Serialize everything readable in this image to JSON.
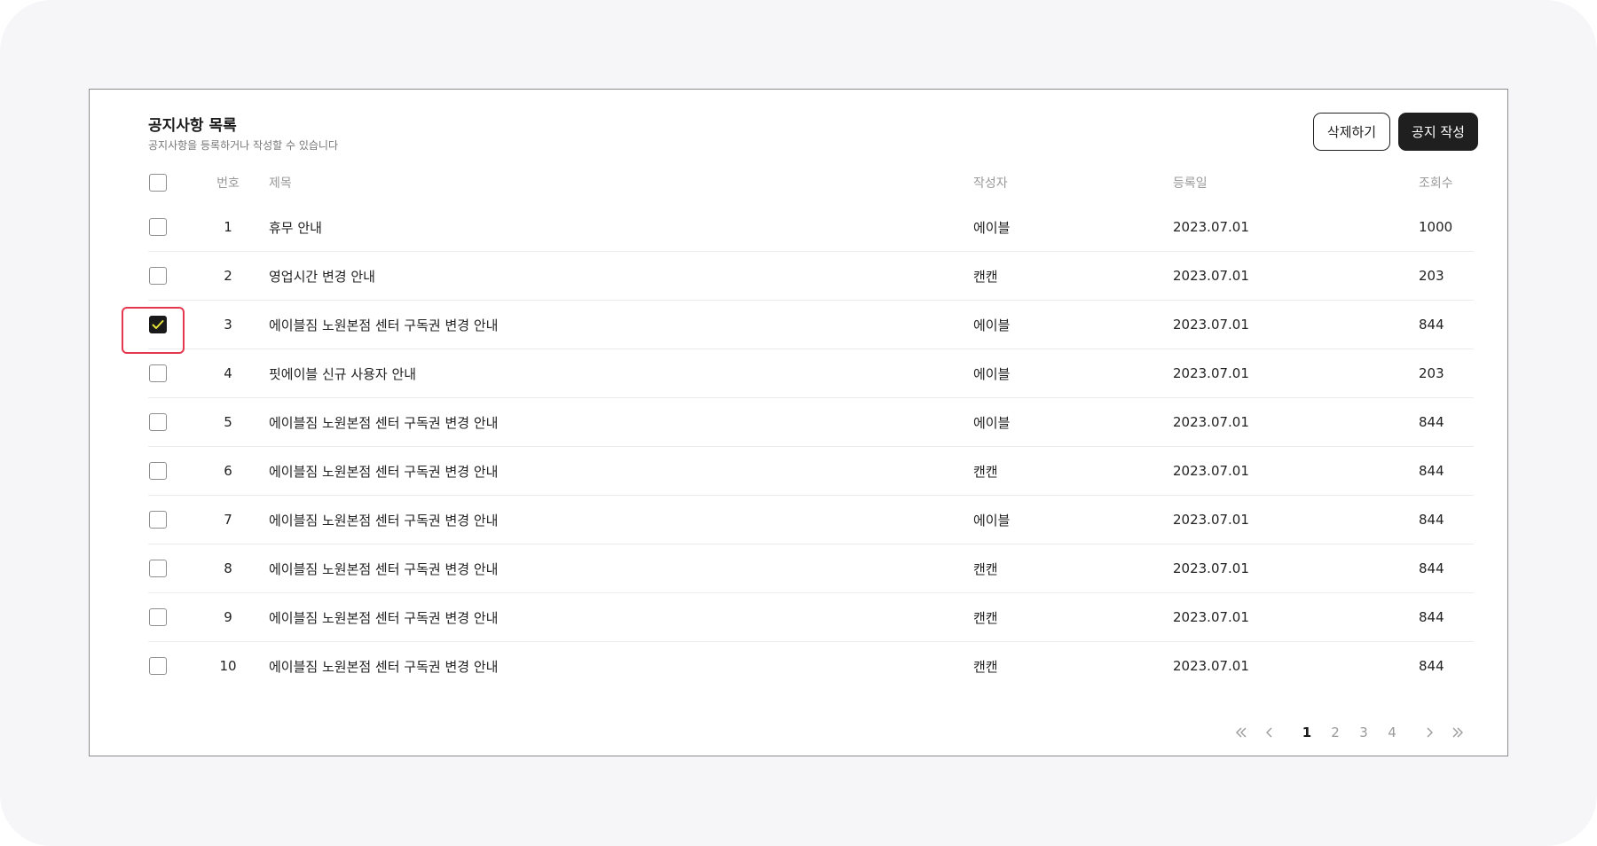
{
  "header": {
    "title": "공지사항 목록",
    "subtitle": "공지사항을 등록하거나 작성할 수 있습니다",
    "delete_label": "삭제하기",
    "write_label": "공지 작성"
  },
  "table": {
    "columns": {
      "number": "번호",
      "title": "제목",
      "author": "작성자",
      "date": "등록일",
      "views": "조회수"
    },
    "rows": [
      {
        "number": "1",
        "title": "휴무 안내",
        "author": "에이블",
        "date": "2023.07.01",
        "views": "1000",
        "checked": false
      },
      {
        "number": "2",
        "title": "영업시간 변경 안내",
        "author": "캔캔",
        "date": "2023.07.01",
        "views": "203",
        "checked": false
      },
      {
        "number": "3",
        "title": "에이블짐 노원본점 센터 구독권 변경 안내",
        "author": "에이블",
        "date": "2023.07.01",
        "views": "844",
        "checked": true
      },
      {
        "number": "4",
        "title": "핏에이블 신규 사용자 안내",
        "author": "에이블",
        "date": "2023.07.01",
        "views": "203",
        "checked": false
      },
      {
        "number": "5",
        "title": "에이블짐 노원본점 센터 구독권 변경 안내",
        "author": "에이블",
        "date": "2023.07.01",
        "views": "844",
        "checked": false
      },
      {
        "number": "6",
        "title": "에이블짐 노원본점 센터 구독권 변경 안내",
        "author": "캔캔",
        "date": "2023.07.01",
        "views": "844",
        "checked": false
      },
      {
        "number": "7",
        "title": "에이블짐 노원본점 센터 구독권 변경 안내",
        "author": "에이블",
        "date": "2023.07.01",
        "views": "844",
        "checked": false
      },
      {
        "number": "8",
        "title": "에이블짐 노원본점 센터 구독권 변경 안내",
        "author": "캔캔",
        "date": "2023.07.01",
        "views": "844",
        "checked": false
      },
      {
        "number": "9",
        "title": "에이블짐 노원본점 센터 구독권 변경 안내",
        "author": "캔캔",
        "date": "2023.07.01",
        "views": "844",
        "checked": false
      },
      {
        "number": "10",
        "title": "에이블짐 노원본점 센터 구독권 변경 안내",
        "author": "캔캔",
        "date": "2023.07.01",
        "views": "844",
        "checked": false
      }
    ]
  },
  "pagination": {
    "pages": [
      "1",
      "2",
      "3",
      "4"
    ],
    "current": "1",
    "icons": [
      "chevrons-left-icon",
      "chevron-left-icon",
      "chevron-right-icon",
      "chevrons-right-icon"
    ]
  },
  "colors": {
    "check_accent": "#e8e53a",
    "highlight": "#e5384f",
    "primary_button": "#1f1f1f"
  }
}
